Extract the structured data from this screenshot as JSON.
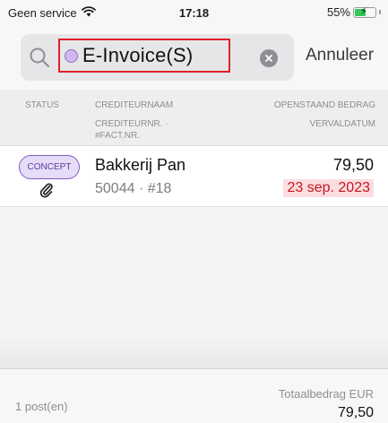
{
  "status_bar": {
    "carrier": "Geen service",
    "time": "17:18",
    "battery": "55%",
    "battery_level": 0.55
  },
  "search": {
    "token_label": "E-Invoice(S)",
    "cancel_label": "Annuleer"
  },
  "columns": {
    "status": "STATUS",
    "creditor_name": "CREDITEURNAAM",
    "creditor_number": "CREDITEURNR. · #FACT.NR.",
    "open_amount": "OPENSTAAND BEDRAG",
    "due_date": "VERVALDATUM"
  },
  "rows": [
    {
      "status": "CONCEPT",
      "name": "Bakkerij Pan",
      "number": "50044 · #18",
      "amount": "79,50",
      "due_date": "23 sep. 2023",
      "has_attachment": true
    }
  ],
  "footer": {
    "count": "1 post(en)",
    "total_label": "Totaalbedrag EUR",
    "total": "79,50"
  },
  "colors": {
    "token_border": "#e0202a",
    "token_dot": "#cdb8f0",
    "badge_border": "#7d5cc4",
    "overdue_text": "#c8151f",
    "overdue_bg": "#fbdde0",
    "battery": "#34c759"
  },
  "icons": [
    "wifi-icon",
    "battery-icon",
    "search-icon",
    "clear-icon",
    "paperclip-icon"
  ]
}
